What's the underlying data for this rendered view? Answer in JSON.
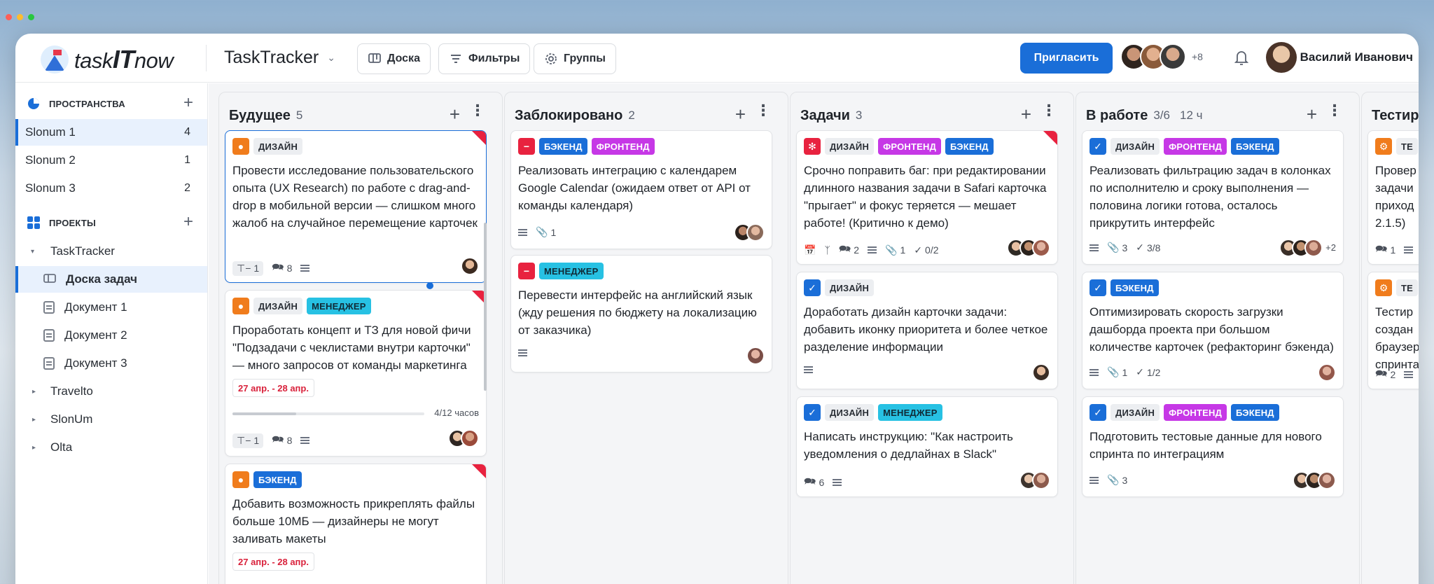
{
  "colors": {
    "accent": "#1a6ed8",
    "urgent": "#e8223f",
    "backend": "#1a6ed8",
    "frontend": "#c638e6",
    "manager": "#27c1e3"
  },
  "app": {
    "logo_prefix": "task",
    "logo_bold": "IT",
    "logo_suffix": "now"
  },
  "header": {
    "project": "TaskTracker",
    "buttons": {
      "board": "Доска",
      "filters": "Фильтры",
      "groups": "Группы"
    },
    "invite": "Пригласить",
    "avatars_more": "+8",
    "user_name": "Василий Иванович"
  },
  "sidebar": {
    "spaces_title": "ПРОСТРАНСТВА",
    "spaces": [
      {
        "label": "Slonum 1",
        "count": "4"
      },
      {
        "label": "Slonum 2",
        "count": "1"
      },
      {
        "label": "Slonum 3",
        "count": "2"
      }
    ],
    "projects_title": "ПРОЕКТЫ",
    "project_main": "TaskTracker",
    "project_items": [
      "Доска задач",
      "Документ 1",
      "Документ 2",
      "Документ 3"
    ],
    "other_projects": [
      "Travelto",
      "SlonUm",
      "Olta"
    ]
  },
  "columns": [
    {
      "title": "Будущее",
      "count": "5"
    },
    {
      "title": "Заблокировано",
      "count": "2"
    },
    {
      "title": "Задачи",
      "count": "3"
    },
    {
      "title": "В работе",
      "count": "3/6",
      "time": "12 ч"
    },
    {
      "title": "Тестир"
    }
  ],
  "tags": {
    "design": "ДИЗАЙН",
    "backend": "БЭКЕНД",
    "frontend": "ФРОНТЕНД",
    "manager": "МЕНЕДЖЕР",
    "test": "ТЕ"
  },
  "cards": {
    "c1": {
      "text": "Провести исследование пользовательского опыта (UX Research) по работе с drag-and-drop в мобильной версии — слишком много жалоб на случайное перемещение карточек",
      "links": "1",
      "comments": "8"
    },
    "c2": {
      "text": "Проработать концепт и ТЗ для новой фичи \"Подзадачи с чеклистами внутри карточки\" — много запросов от команды маркетинга",
      "date": "27 апр. - 28 апр.",
      "progress": 0.333,
      "progress_label": "4/12 часов",
      "links": "1",
      "comments": "8"
    },
    "c3": {
      "text": "Добавить возможность прикреплять файлы больше 10МБ — дизайнеры не могут заливать макеты",
      "date": "27 апр. - 28 апр."
    },
    "c4": {
      "text": "Реализовать интеграцию с календарем Google Calendar (ожидаем ответ от API от команды календаря)",
      "attach": "1"
    },
    "c5": {
      "text": "Перевести интерфейс на английский язык (жду решения по бюджету на локализацию от заказчика)"
    },
    "c6": {
      "text": "Срочно поправить баг: при редактировании длинного названия задачи в Safari карточка \"прыгает\" и фокус теряется — мешает работе! (Критично к демо)",
      "comments": "2",
      "attach": "1",
      "checks": "0/2"
    },
    "c7": {
      "text": "Доработать дизайн карточки задачи: добавить иконку приоритета и более четкое разделение информации"
    },
    "c8": {
      "text": "Написать инструкцию: \"Как настроить уведомления о дедлайнах в Slack\"",
      "comments": "6"
    },
    "c9": {
      "text": "Реализовать фильтрацию задач в колонках по исполнителю и сроку выполнения — половина логики готова, осталось прикрутить интерфейс",
      "attach": "3",
      "checks": "3/8",
      "more": "+2"
    },
    "c10": {
      "text": "Оптимизировать скорость загрузки дашборда проекта при большом количестве карточек (рефакторинг бэкенда)",
      "attach": "1",
      "checks": "1/2"
    },
    "c11": {
      "text": "Подготовить тестовые данные для нового спринта по интеграциям",
      "attach": "3"
    },
    "c12": {
      "text": "Провер задачи приход 2.1.5)",
      "comments": "1"
    },
    "c13": {
      "text": "Тестир создан браузер спринта",
      "comments": "2"
    }
  }
}
